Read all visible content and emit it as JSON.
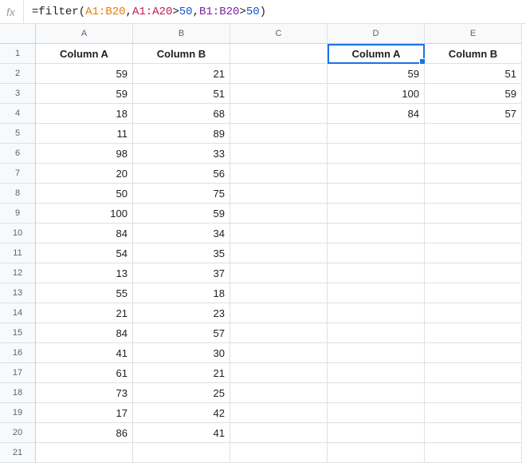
{
  "formula_bar": {
    "fx_label": "fx",
    "parts": {
      "eq": "=",
      "fn": "filter",
      "open": "(",
      "range1": "A1:B20",
      "comma1": ",",
      "range2": "A1:A20",
      "gt1": ">",
      "num1": "50",
      "comma2": ",",
      "range3": "B1:B20",
      "gt2": ">",
      "num2": "50",
      "close": ")"
    }
  },
  "columns": [
    "A",
    "B",
    "C",
    "D",
    "E"
  ],
  "row_count": 21,
  "selected_cell": "D1",
  "headers": {
    "A1": "Column A",
    "B1": "Column B",
    "D1": "Column A",
    "E1": "Column B"
  },
  "data": {
    "A": [
      59,
      59,
      18,
      11,
      98,
      20,
      50,
      100,
      84,
      54,
      13,
      55,
      21,
      84,
      41,
      61,
      73,
      17,
      86
    ],
    "B": [
      21,
      51,
      68,
      89,
      33,
      56,
      75,
      59,
      34,
      35,
      37,
      18,
      23,
      57,
      30,
      21,
      25,
      42,
      41
    ],
    "D": [
      59,
      100,
      84
    ],
    "E": [
      51,
      59,
      57
    ]
  }
}
